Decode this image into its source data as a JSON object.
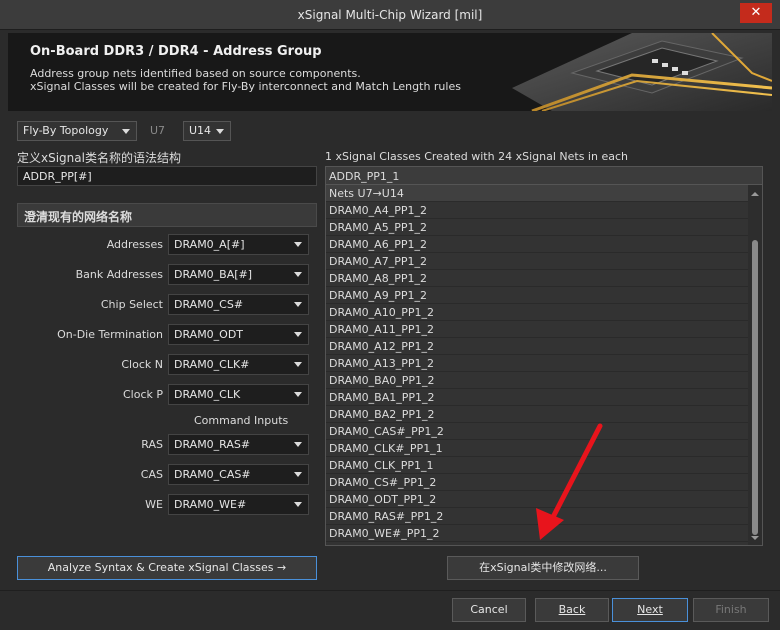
{
  "window": {
    "title": "xSignal Multi-Chip Wizard [mil]",
    "close_glyph": "✕"
  },
  "banner": {
    "title": "On-Board DDR3 / DDR4 - Address Group",
    "desc_line1": "Address group nets identified based on source components.",
    "desc_line2": "xSignal Classes will be created for Fly-By interconnect and Match Length rules"
  },
  "topology": {
    "value": "Fly-By Topology",
    "source_comp": "U7",
    "dest_comp": "U14"
  },
  "syntax": {
    "label": "定义xSignal类名称的语法结构",
    "value": "ADDR_PP[#]"
  },
  "section": {
    "title": "澄清现有的网络名称"
  },
  "fields": [
    {
      "label": "Addresses",
      "value": "DRAM0_A[#]"
    },
    {
      "label": "Bank Addresses",
      "value": "DRAM0_BA[#]"
    },
    {
      "label": "Chip Select",
      "value": "DRAM0_CS#"
    },
    {
      "label": "On-Die Termination",
      "value": "DRAM0_ODT"
    },
    {
      "label": "Clock N",
      "value": "DRAM0_CLK#"
    },
    {
      "label": "Clock P",
      "value": "DRAM0_CLK"
    }
  ],
  "command_inputs": {
    "heading": "Command Inputs",
    "fields": [
      {
        "label": "RAS",
        "value": "DRAM0_RAS#"
      },
      {
        "label": "CAS",
        "value": "DRAM0_CAS#"
      },
      {
        "label": "WE",
        "value": "DRAM0_WE#"
      }
    ]
  },
  "results": {
    "summary": "1 xSignal Classes Created with 24 xSignal Nets in each",
    "class_name": "ADDR_PP1_1",
    "nets_header": "Nets U7→U14",
    "nets": [
      "DRAM0_A4_PP1_2",
      "DRAM0_A5_PP1_2",
      "DRAM0_A6_PP1_2",
      "DRAM0_A7_PP1_2",
      "DRAM0_A8_PP1_2",
      "DRAM0_A9_PP1_2",
      "DRAM0_A10_PP1_2",
      "DRAM0_A11_PP1_2",
      "DRAM0_A12_PP1_2",
      "DRAM0_A13_PP1_2",
      "DRAM0_BA0_PP1_2",
      "DRAM0_BA1_PP1_2",
      "DRAM0_BA2_PP1_2",
      "DRAM0_CAS#_PP1_2",
      "DRAM0_CLK#_PP1_1",
      "DRAM0_CLK_PP1_1",
      "DRAM0_CS#_PP1_2",
      "DRAM0_ODT_PP1_2",
      "DRAM0_RAS#_PP1_2",
      "DRAM0_WE#_PP1_2"
    ]
  },
  "buttons": {
    "analyze": "Analyze Syntax & Create xSignal Classes →",
    "modify": "在xSignal类中修改网络...",
    "cancel": "Cancel",
    "back": "Back",
    "next": "Next",
    "finish": "Finish"
  },
  "colors": {
    "accent": "#4a90d9",
    "annotation_arrow": "#e8141c",
    "close": "#c42b1c"
  }
}
